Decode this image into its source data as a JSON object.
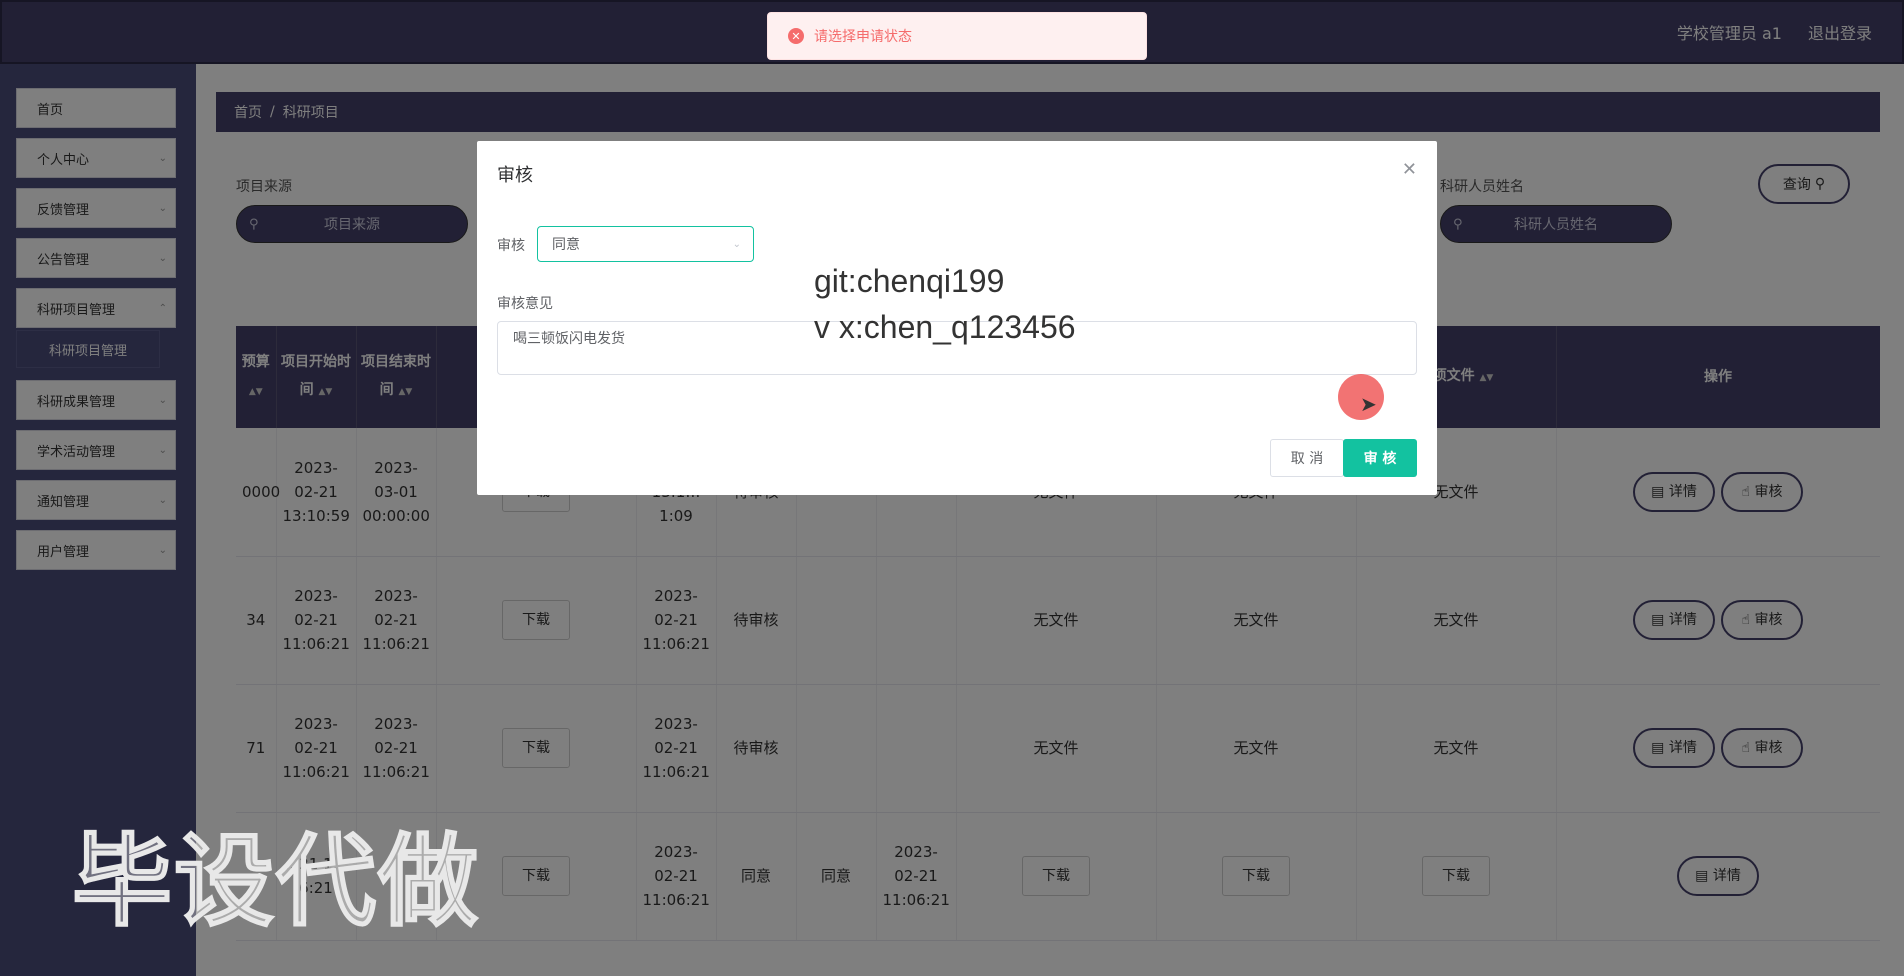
{
  "header": {
    "user_label": "学校管理员 a1",
    "logout_label": "退出登录"
  },
  "sidebar": {
    "items": [
      {
        "label": "首页",
        "has_children": false
      },
      {
        "label": "个人中心",
        "has_children": true
      },
      {
        "label": "反馈管理",
        "has_children": true
      },
      {
        "label": "公告管理",
        "has_children": true
      },
      {
        "label": "科研项目管理",
        "has_children": true
      },
      {
        "label": "科研成果管理",
        "has_children": true
      },
      {
        "label": "学术活动管理",
        "has_children": true
      },
      {
        "label": "通知管理",
        "has_children": true
      },
      {
        "label": "用户管理",
        "has_children": true
      }
    ],
    "active_sub": "科研项目管理"
  },
  "breadcrumb": {
    "home": "首页",
    "sep": "/",
    "current": "科研项目"
  },
  "search": {
    "source_label": "项目来源",
    "source_placeholder": "项目来源",
    "researcher_label": "科研人员姓名",
    "researcher_placeholder": "科研人员姓名",
    "query_label": "查询"
  },
  "table": {
    "headers": {
      "budget": "预算",
      "start": "项目开始时间",
      "end": "项目结束时间",
      "close_file": "结项文件",
      "ops": "操作"
    },
    "rows": [
      {
        "budget": "0000",
        "start": "2023-02-21 13:10:59",
        "end": "2023-03-01 00:00:00",
        "download": "下载",
        "apply_time": "…21 13:1…1:09",
        "status": "待审核",
        "col_a": "",
        "col_b": "",
        "file1": "无文件",
        "file2": "无文件",
        "file3": "无文件"
      },
      {
        "budget": "34",
        "start": "2023-02-21 11:06:21",
        "end": "2023-02-21 11:06:21",
        "download": "下载",
        "apply_time": "2023-02-21 11:06:21",
        "status": "待审核",
        "col_a": "",
        "col_b": "",
        "file1": "无文件",
        "file2": "无文件",
        "file3": "无文件"
      },
      {
        "budget": "71",
        "start": "2023-02-21 11:06:21",
        "end": "2023-02-21 11:06:21",
        "download": "下载",
        "apply_time": "2023-02-21 11:06:21",
        "status": "待审核",
        "col_a": "",
        "col_b": "",
        "file1": "无文件",
        "file2": "无文件",
        "file3": "无文件"
      },
      {
        "budget": "",
        "start": "…21 1…6:21",
        "end": "",
        "download": "下载",
        "apply_time": "2023-02-21 11:06:21",
        "status": "同意",
        "col_a": "同意",
        "col_b": "2023-02-21 11:06:21",
        "file1": "下载",
        "file2": "下载",
        "file3": "下载"
      }
    ],
    "detail_label": "详情",
    "review_label": "审核"
  },
  "toast": {
    "message": "请选择申请状态",
    "type": "error"
  },
  "dialog": {
    "title": "审核",
    "status_label": "审核",
    "status_value": "同意",
    "comment_label": "审核意见",
    "comment_value": "喝三顿饭闪电发货",
    "cancel_label": "取 消",
    "confirm_label": "审 核"
  },
  "watermark": {
    "line1": "git:chenqi199",
    "line2": "v x:chen_q123456",
    "big": "毕设代做"
  },
  "colors": {
    "primary": "#45416a",
    "accent": "#13c2a0",
    "error": "#f56c6c"
  }
}
